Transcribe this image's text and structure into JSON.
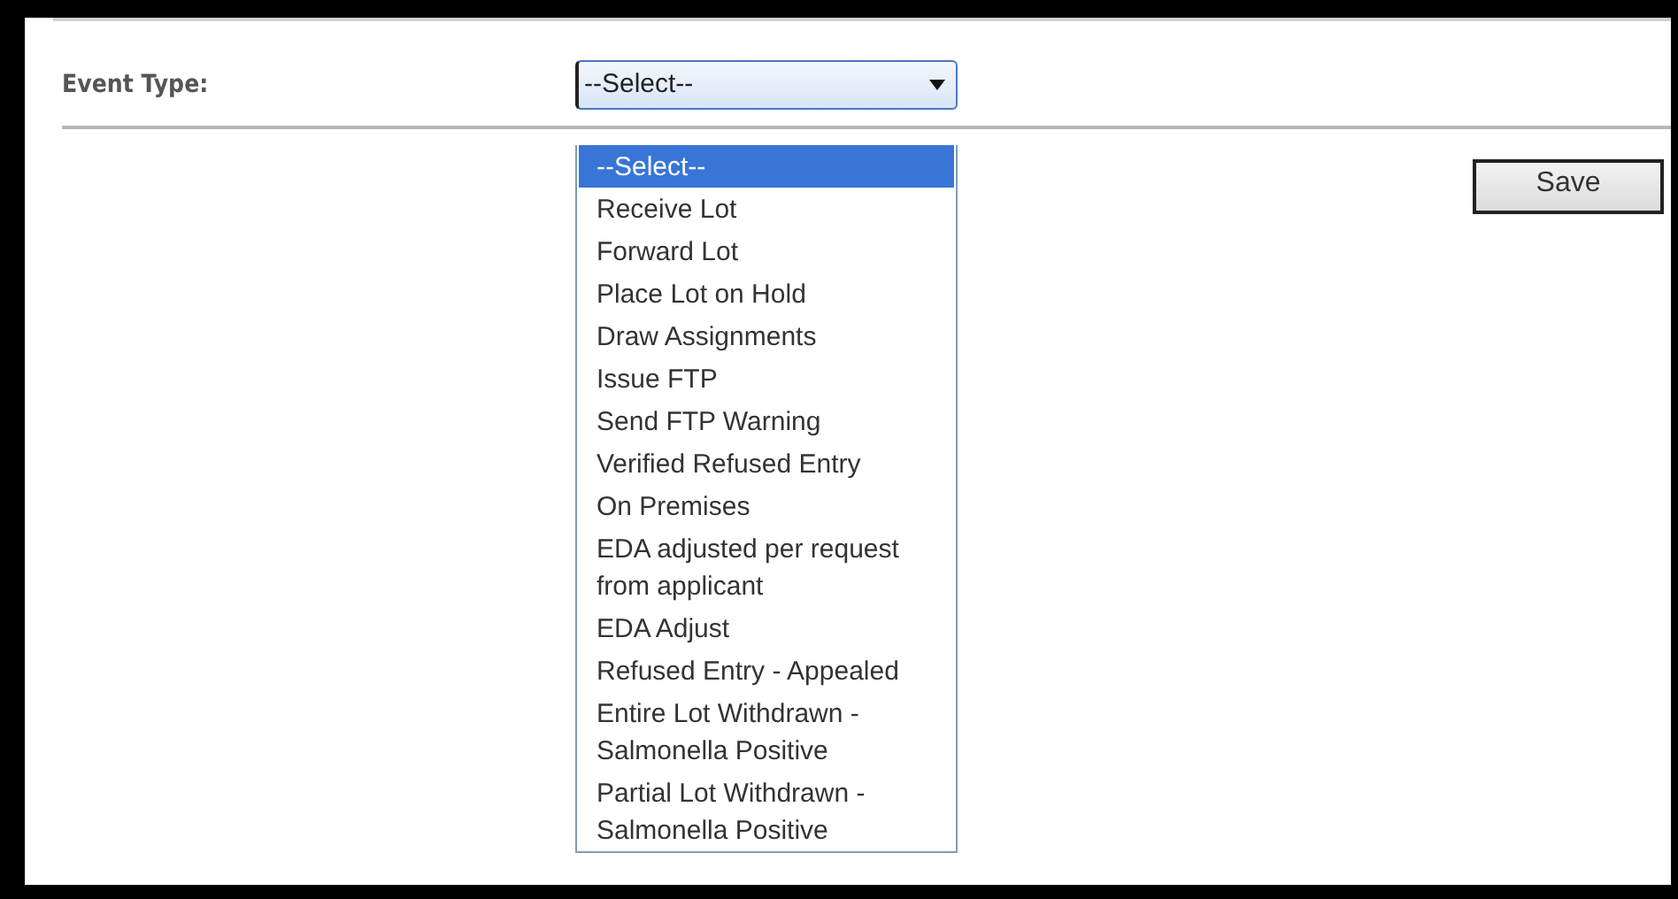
{
  "form": {
    "event_type": {
      "label": "Event Type:",
      "value": "--Select--",
      "expanded": true,
      "options": [
        {
          "label": "--Select--",
          "selected": true
        },
        {
          "label": "Receive Lot",
          "selected": false
        },
        {
          "label": "Forward Lot",
          "selected": false
        },
        {
          "label": "Place Lot on Hold",
          "selected": false
        },
        {
          "label": "Draw Assignments",
          "selected": false
        },
        {
          "label": "Issue FTP",
          "selected": false
        },
        {
          "label": "Send FTP Warning",
          "selected": false
        },
        {
          "label": "Verified Refused Entry",
          "selected": false
        },
        {
          "label": "On Premises",
          "selected": false
        },
        {
          "label": "EDA adjusted per request from applicant",
          "selected": false
        },
        {
          "label": "EDA Adjust",
          "selected": false
        },
        {
          "label": "Refused Entry - Appealed",
          "selected": false
        },
        {
          "label": "Entire Lot Withdrawn - Salmonella Positive",
          "selected": false
        },
        {
          "label": "Partial Lot Withdrawn - Salmonella Positive",
          "selected": false
        }
      ]
    },
    "save_button": "Save"
  }
}
